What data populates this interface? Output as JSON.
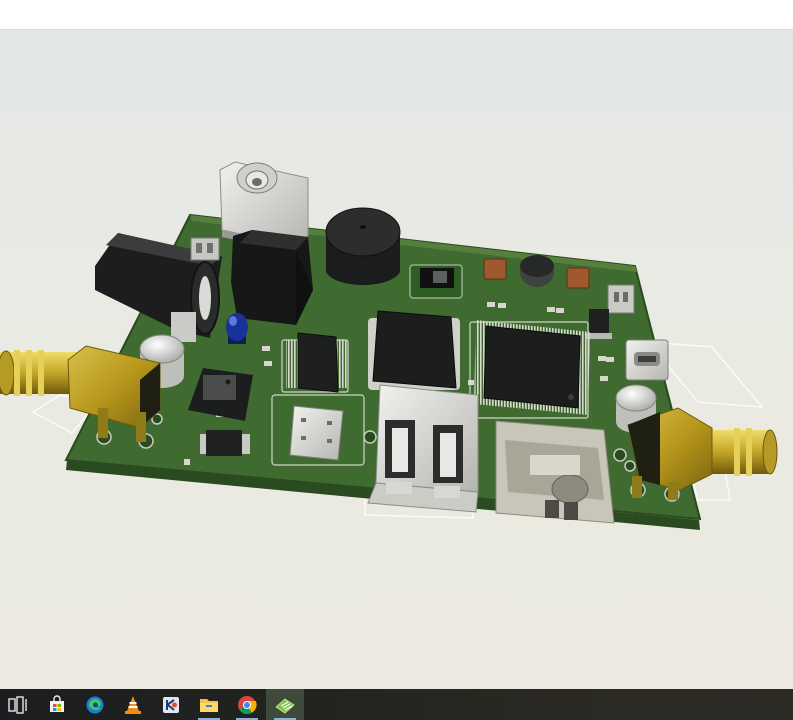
{
  "window": {
    "title_bar": ""
  },
  "viewport": {
    "content": "pcb-3d-model"
  },
  "taskbar": {
    "items": [
      {
        "name": "task-view",
        "icon": "task-view-icon",
        "running": false,
        "active": false
      },
      {
        "name": "microsoft-store",
        "icon": "store-icon",
        "running": false,
        "active": false
      },
      {
        "name": "edge",
        "icon": "edge-icon",
        "running": false,
        "active": false
      },
      {
        "name": "vlc",
        "icon": "vlc-icon",
        "running": false,
        "active": false
      },
      {
        "name": "app-k",
        "icon": "app-k-icon",
        "running": false,
        "active": false
      },
      {
        "name": "file-explorer",
        "icon": "folder-icon",
        "running": true,
        "active": false
      },
      {
        "name": "chrome",
        "icon": "chrome-icon",
        "running": true,
        "active": false
      },
      {
        "name": "pcb-design-app",
        "icon": "pcb-app-icon",
        "running": true,
        "active": true
      }
    ]
  },
  "colors": {
    "pcb_green": "#3f6a30",
    "pcb_edge": "#2a4a20",
    "gold": "#b89a1c",
    "ic_black": "#1e2020",
    "taskbar": "#1f2022"
  }
}
